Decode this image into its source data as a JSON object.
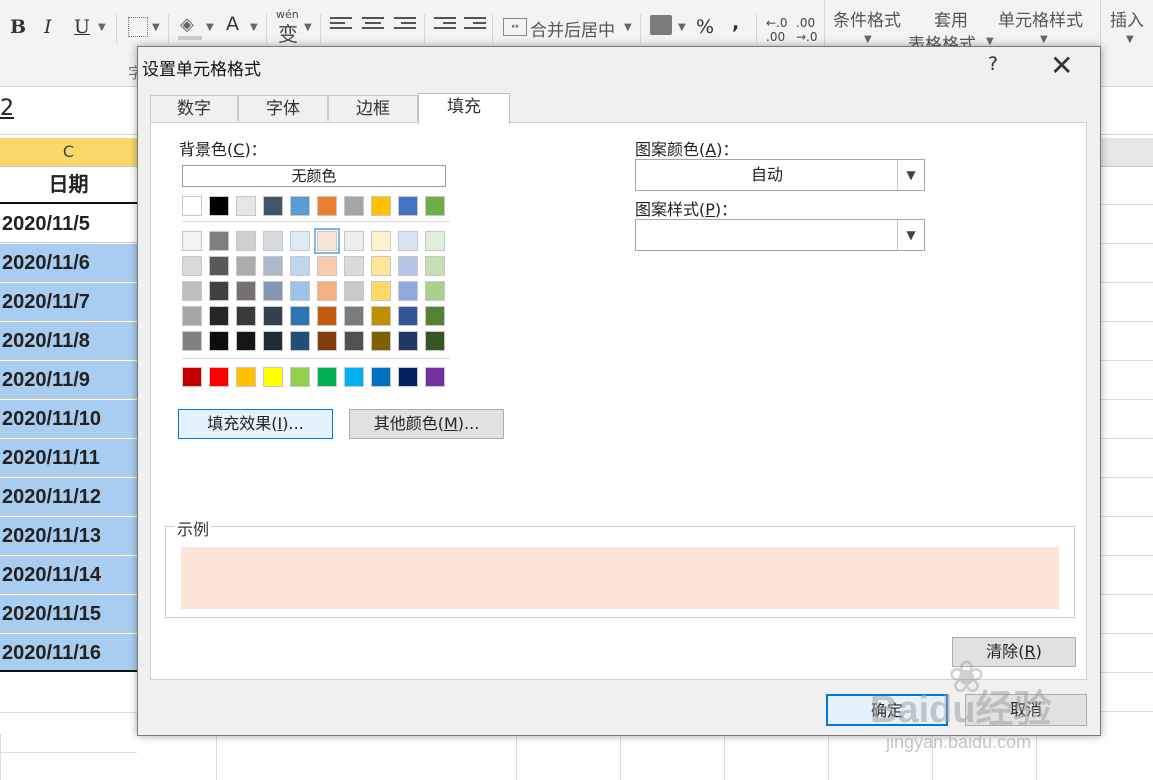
{
  "ribbon": {
    "bold": "B",
    "italic": "I",
    "underline": "U",
    "font_color": "A",
    "phonetic": "wén",
    "phonetic_char": "变",
    "merge_center": "合并后居中",
    "percent": "%",
    "comma": ",",
    "conditional_format": "条件格式",
    "apply": "套用",
    "table_format": "表格格式",
    "cell_styles": "单元格样式",
    "insert": "插入"
  },
  "sheet": {
    "name_box_fragment": "2",
    "column_header": "C",
    "header_cell": "日期",
    "rows": [
      "2020/11/5",
      "2020/11/6",
      "2020/11/7",
      "2020/11/8",
      "2020/11/9",
      "2020/11/10",
      "2020/11/11",
      "2020/11/12",
      "2020/11/13",
      "2020/11/14",
      "2020/11/15",
      "2020/11/16"
    ],
    "selected_from_index": 1
  },
  "dialog": {
    "title": "设置单元格格式",
    "help": "?",
    "close": "✕",
    "tabs": [
      {
        "label": "数字",
        "active": false
      },
      {
        "label": "字体",
        "active": false
      },
      {
        "label": "边框",
        "active": false
      },
      {
        "label": "填充",
        "active": true
      }
    ],
    "background_color": {
      "label": "背景色",
      "key": "C"
    },
    "no_color": "无颜色",
    "theme_row": [
      "#ffffff",
      "#000000",
      "#e7e6e6",
      "#44546a",
      "#5b9bd5",
      "#ed7d31",
      "#a5a5a5",
      "#ffc000",
      "#4472c4",
      "#70ad47"
    ],
    "tint_rows": [
      [
        "#f2f2f2",
        "#7f7f7f",
        "#d0cece",
        "#d6dce4",
        "#deebf6",
        "#fbe5d6",
        "#ededed",
        "#fff2cc",
        "#d9e2f3",
        "#e2efda"
      ],
      [
        "#d9d9d9",
        "#595959",
        "#aeabab",
        "#adb9ca",
        "#bdd7ee",
        "#f8cbad",
        "#dbdbdb",
        "#ffe699",
        "#b4c6e7",
        "#c6e0b4"
      ],
      [
        "#bfbfbf",
        "#404040",
        "#757171",
        "#8497b0",
        "#9dc3e6",
        "#f4b183",
        "#c9c9c9",
        "#ffd966",
        "#8ea9db",
        "#a9d08e"
      ],
      [
        "#a6a6a6",
        "#262626",
        "#3a3838",
        "#333f4f",
        "#2e75b6",
        "#c55a11",
        "#7b7b7b",
        "#bf8f00",
        "#2f5597",
        "#548235"
      ],
      [
        "#808080",
        "#0d0d0d",
        "#171616",
        "#222a35",
        "#1f4e79",
        "#843c0c",
        "#525252",
        "#7f6000",
        "#1f3864",
        "#375623"
      ]
    ],
    "standard_row": [
      "#c00000",
      "#ff0000",
      "#ffc000",
      "#ffff00",
      "#92d050",
      "#00b050",
      "#00b0f0",
      "#0070c0",
      "#002060",
      "#7030a0"
    ],
    "selected_color": "#fbe5d6",
    "fill_effects": {
      "label": "填充效果",
      "key": "I",
      "suffix": "..."
    },
    "more_colors": {
      "label": "其他颜色",
      "key": "M",
      "suffix": "..."
    },
    "pattern_color": {
      "label": "图案颜色",
      "key": "A",
      "value": "自动"
    },
    "pattern_style": {
      "label": "图案样式",
      "key": "P",
      "value": ""
    },
    "sample_label": "示例",
    "clear": {
      "label": "清除",
      "key": "R"
    },
    "ok": "确定",
    "cancel": "取消"
  },
  "watermark": {
    "brand": "Baidu经验",
    "url": "jingyan.baidu.com"
  }
}
